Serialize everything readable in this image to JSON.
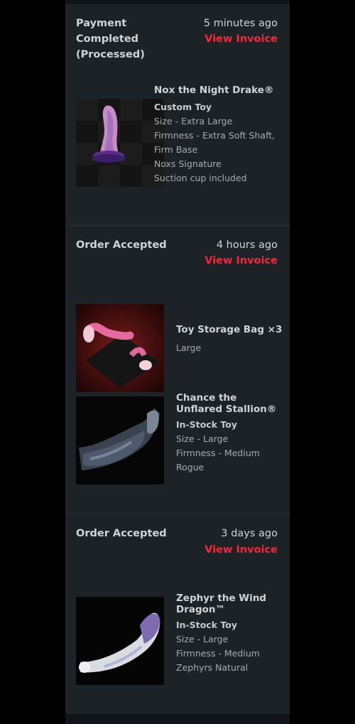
{
  "orders": [
    {
      "status": "Payment Completed (Processed)",
      "time": "5 minutes ago",
      "invoice_label": "View Invoice",
      "items": [
        {
          "name": "Nox the Night Drake®",
          "type": "Custom Toy",
          "details": [
            "Size - Extra Large",
            "Firmness - Extra Soft Shaft,",
            "Firm Base",
            "Noxs Signature",
            "Suction cup included"
          ]
        }
      ]
    },
    {
      "status": "Order Accepted",
      "time": "4 hours ago",
      "invoice_label": "View Invoice",
      "items": [
        {
          "name": "Toy Storage Bag ×3",
          "details": [
            "Large"
          ]
        },
        {
          "name": "Chance the Unflared Stallion®",
          "type": "In-Stock Toy",
          "details": [
            "Size - Large",
            "Firmness - Medium",
            "Rogue"
          ]
        }
      ]
    },
    {
      "status": "Order Accepted",
      "time": "3 days ago",
      "invoice_label": "View Invoice",
      "items": [
        {
          "name": "Zephyr the Wind Dragon™",
          "type": "In-Stock Toy",
          "details": [
            "Size - Large",
            "Firmness - Medium",
            "Zephyrs Natural"
          ]
        }
      ]
    }
  ],
  "colors": {
    "accent": "#f02a3c",
    "panel": "#1d2227",
    "text": "#d0d4d8",
    "muted": "#a6acb2"
  }
}
